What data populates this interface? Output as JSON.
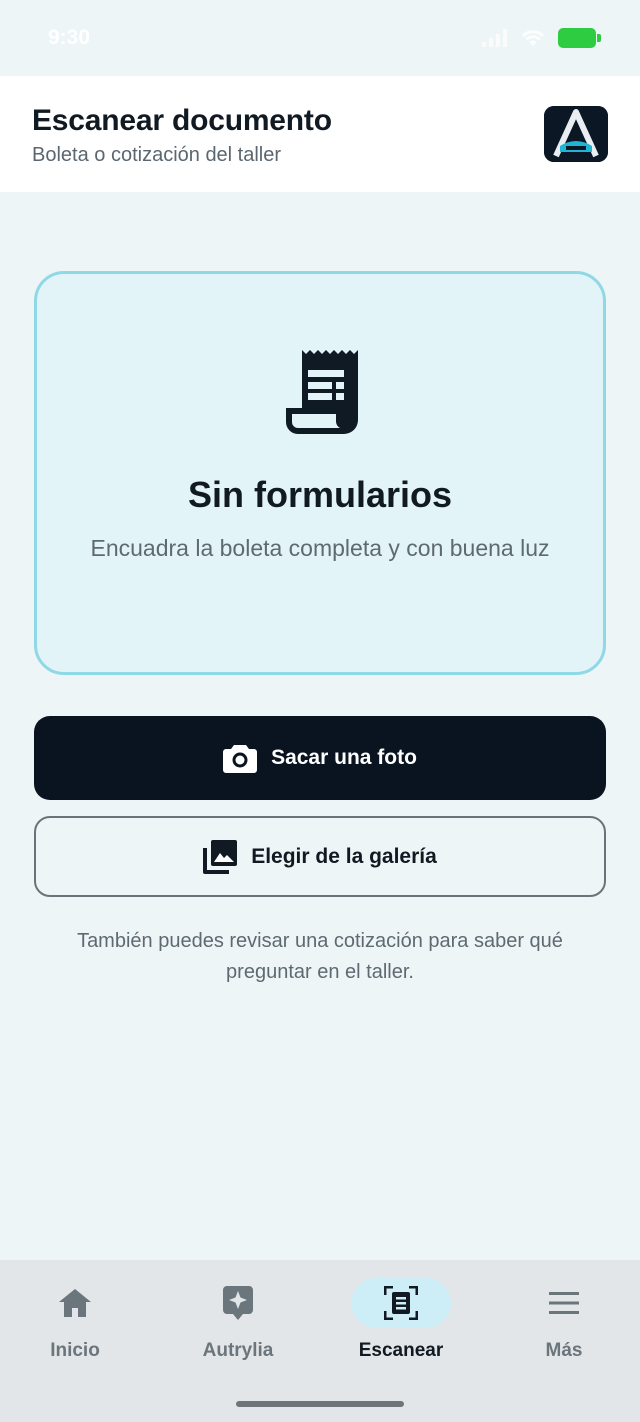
{
  "status_bar": {
    "time": "9:30"
  },
  "header": {
    "title": "Escanear documento",
    "subtitle": "Boleta o cotización del taller",
    "logo_icon": "autrylia-logo-icon"
  },
  "scan_card": {
    "icon": "receipt-icon",
    "title": "Sin formularios",
    "description": "Encuadra la boleta completa y con buena luz"
  },
  "actions": {
    "take_photo": {
      "label": "Sacar una foto",
      "icon": "camera-icon"
    },
    "gallery": {
      "label": "Elegir de la galería",
      "icon": "gallery-icon"
    }
  },
  "hint": "También puedes revisar una cotización para saber qué preguntar en el taller.",
  "bottom_nav": {
    "items": [
      {
        "label": "Inicio",
        "icon": "home-icon",
        "active": false
      },
      {
        "label": "Autrylia",
        "icon": "sparkle-icon",
        "active": false
      },
      {
        "label": "Escanear",
        "icon": "scan-document-icon",
        "active": true
      },
      {
        "label": "Más",
        "icon": "menu-icon",
        "active": false
      }
    ]
  },
  "colors": {
    "accent_border": "#8fd8e6",
    "card_bg": "#e3f4f9",
    "primary_button": "#0a1420",
    "battery": "#2ecc40",
    "nav_active_pill": "#cdeef6"
  }
}
